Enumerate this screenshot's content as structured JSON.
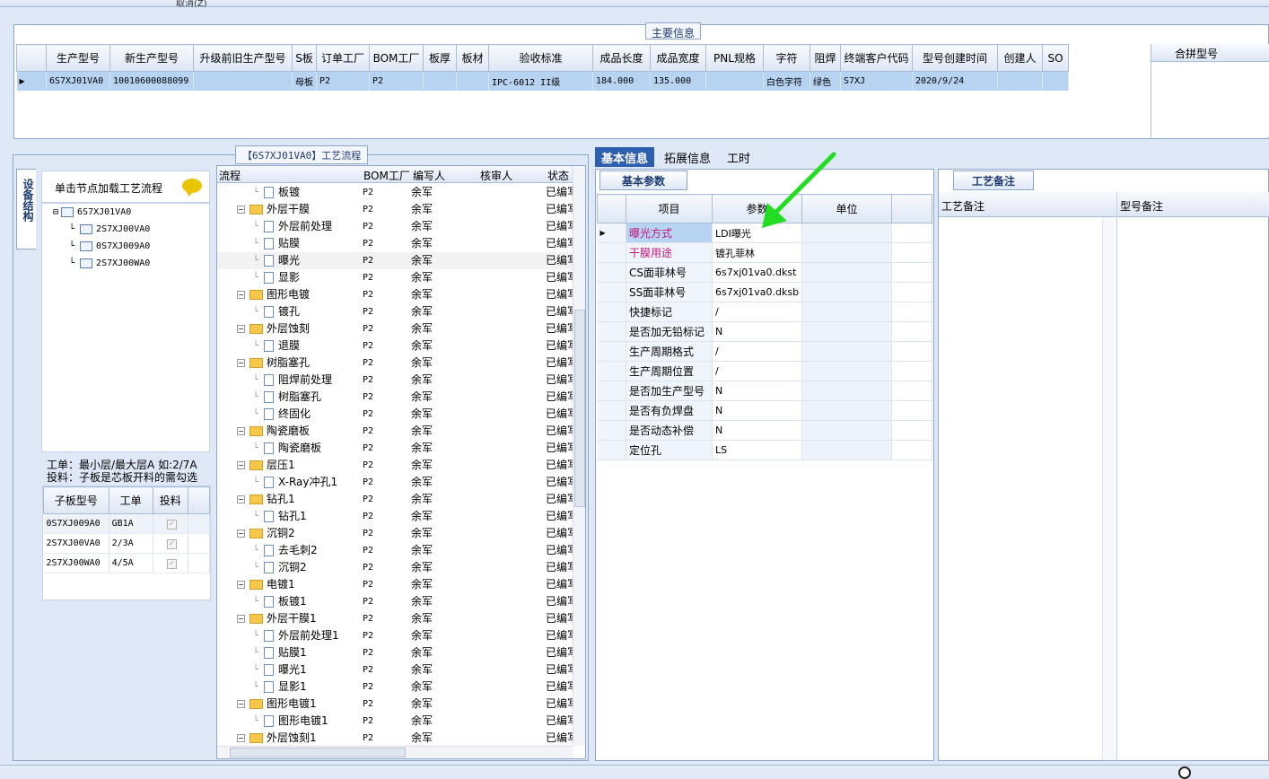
{
  "toolbar": {
    "cancel_label": "取消(Z)"
  },
  "main_info": {
    "legend": "主要信息",
    "columns": [
      "生产型号",
      "新生产型号",
      "升级前旧生产型号",
      "S板",
      "订单工厂",
      "BOM工厂",
      "板厚",
      "板材",
      "验收标准",
      "成品长度",
      "成品宽度",
      "PNL规格",
      "字符",
      "阻焊",
      "终端客户代码",
      "型号创建时间",
      "创建人",
      "SO"
    ],
    "row": [
      "6S7XJ01VA0",
      "10010600088099",
      "",
      "母板",
      "P2",
      "P2",
      "",
      "",
      "IPC-6012 II级",
      "184.000",
      "135.000",
      "",
      "白色字符",
      "绿色",
      "S7XJ",
      "2020/9/24",
      "",
      ""
    ],
    "merge_col": "合拼型号"
  },
  "left_panel": {
    "title": "【6S7XJ01VA0】工艺流程",
    "vertical_tab": "设备结构",
    "node_load_text": "单击节点加载工艺流程",
    "tree_root": "6S7XJ01VA0",
    "tree_children": [
      "2S7XJ00VA0",
      "0S7XJ009A0",
      "2S7XJ00WA0"
    ],
    "note_line1": "工单：最小层/最大层A 如:2/7A",
    "note_line2": "投料：子板是芯板开料的需勾选",
    "sub_columns": [
      "子板型号",
      "工单",
      "投料"
    ],
    "sub_rows": [
      {
        "model": "0S7XJ009A0",
        "order": "GB1A",
        "check": "✓"
      },
      {
        "model": "2S7XJ00VA0",
        "order": "2/3A",
        "check": "✓"
      },
      {
        "model": "2S7XJ00WA0",
        "order": "4/5A",
        "check": "✓"
      }
    ]
  },
  "flow": {
    "columns": {
      "process": "流程",
      "bom": "BOM工厂",
      "writer": "编写人",
      "reviewer": "核审人",
      "status": "状态"
    },
    "rows": [
      {
        "name": "板镀",
        "level": 2,
        "bom": "P2",
        "writer": "余军",
        "status": "已编写"
      },
      {
        "name": "外层干膜",
        "level": 1,
        "bom": "P2",
        "writer": "余军",
        "status": "已编写"
      },
      {
        "name": "外层前处理",
        "level": 2,
        "bom": "P2",
        "writer": "余军",
        "status": "已编写"
      },
      {
        "name": "贴膜",
        "level": 2,
        "bom": "P2",
        "writer": "余军",
        "status": "已编写"
      },
      {
        "name": "曝光",
        "level": 2,
        "bom": "P2",
        "writer": "余军",
        "status": "已编写"
      },
      {
        "name": "显影",
        "level": 2,
        "bom": "P2",
        "writer": "余军",
        "status": "已编写"
      },
      {
        "name": "图形电镀",
        "level": 1,
        "bom": "P2",
        "writer": "余军",
        "status": "已编写"
      },
      {
        "name": "镀孔",
        "level": 2,
        "bom": "P2",
        "writer": "余军",
        "status": "已编写"
      },
      {
        "name": "外层蚀刻",
        "level": 1,
        "bom": "P2",
        "writer": "余军",
        "status": "已编写"
      },
      {
        "name": "退膜",
        "level": 2,
        "bom": "P2",
        "writer": "余军",
        "status": "已编写"
      },
      {
        "name": "树脂塞孔",
        "level": 1,
        "bom": "P2",
        "writer": "余军",
        "status": "已编写"
      },
      {
        "name": "阻焊前处理",
        "level": 2,
        "bom": "P2",
        "writer": "余军",
        "status": "已编写"
      },
      {
        "name": "树脂塞孔",
        "level": 2,
        "bom": "P2",
        "writer": "余军",
        "status": "已编写"
      },
      {
        "name": "终固化",
        "level": 2,
        "bom": "P2",
        "writer": "余军",
        "status": "已编写"
      },
      {
        "name": "陶瓷磨板",
        "level": 1,
        "bom": "P2",
        "writer": "余军",
        "status": "已编写"
      },
      {
        "name": "陶瓷磨板",
        "level": 2,
        "bom": "P2",
        "writer": "余军",
        "status": "已编写"
      },
      {
        "name": "层压1",
        "level": 1,
        "bom": "P2",
        "writer": "余军",
        "status": "已编写"
      },
      {
        "name": "X-Ray冲孔1",
        "level": 2,
        "bom": "P2",
        "writer": "余军",
        "status": "已编写"
      },
      {
        "name": "钻孔1",
        "level": 1,
        "bom": "P2",
        "writer": "余军",
        "status": "已编写"
      },
      {
        "name": "钻孔1",
        "level": 2,
        "bom": "P2",
        "writer": "余军",
        "status": "已编写"
      },
      {
        "name": "沉铜2",
        "level": 1,
        "bom": "P2",
        "writer": "余军",
        "status": "已编写"
      },
      {
        "name": "去毛刺2",
        "level": 2,
        "bom": "P2",
        "writer": "余军",
        "status": "已编写"
      },
      {
        "name": "沉铜2",
        "level": 2,
        "bom": "P2",
        "writer": "余军",
        "status": "已编写"
      },
      {
        "name": "电镀1",
        "level": 1,
        "bom": "P2",
        "writer": "余军",
        "status": "已编写"
      },
      {
        "name": "板镀1",
        "level": 2,
        "bom": "P2",
        "writer": "余军",
        "status": "已编写"
      },
      {
        "name": "外层干膜1",
        "level": 1,
        "bom": "P2",
        "writer": "余军",
        "status": "已编写"
      },
      {
        "name": "外层前处理1",
        "level": 2,
        "bom": "P2",
        "writer": "余军",
        "status": "已编写"
      },
      {
        "name": "贴膜1",
        "level": 2,
        "bom": "P2",
        "writer": "余军",
        "status": "已编写"
      },
      {
        "name": "曝光1",
        "level": 2,
        "bom": "P2",
        "writer": "余军",
        "status": "已编写"
      },
      {
        "name": "显影1",
        "level": 2,
        "bom": "P2",
        "writer": "余军",
        "status": "已编写"
      },
      {
        "name": "图形电镀1",
        "level": 1,
        "bom": "P2",
        "writer": "余军",
        "status": "已编写"
      },
      {
        "name": "图形电镀1",
        "level": 2,
        "bom": "P2",
        "writer": "余军",
        "status": "已编写"
      },
      {
        "name": "外层蚀刻1",
        "level": 1,
        "bom": "P2",
        "writer": "余军",
        "status": "已编写"
      }
    ]
  },
  "tabs": [
    "基本信息",
    "拓展信息",
    "工时"
  ],
  "basic": {
    "tab": "基本参数",
    "columns": [
      "项目",
      "参数",
      "单位"
    ],
    "rows": [
      {
        "k": "曝光方式",
        "v": "LDI曝光",
        "u": "",
        "pink": true
      },
      {
        "k": "干膜用途",
        "v": "镀孔菲林",
        "u": "",
        "pink": true
      },
      {
        "k": "CS面菲林号",
        "v": "6s7xj01va0.dkst",
        "u": ""
      },
      {
        "k": "SS面菲林号",
        "v": "6s7xj01va0.dksb",
        "u": ""
      },
      {
        "k": "快捷标记",
        "v": "/",
        "u": ""
      },
      {
        "k": "是否加无铅标记",
        "v": "N",
        "u": ""
      },
      {
        "k": "生产周期格式",
        "v": "/",
        "u": ""
      },
      {
        "k": "生产周期位置",
        "v": "/",
        "u": ""
      },
      {
        "k": "是否加生产型号",
        "v": "N",
        "u": ""
      },
      {
        "k": "是否有负焊盘",
        "v": "N",
        "u": ""
      },
      {
        "k": "是否动态补偿",
        "v": "N",
        "u": ""
      },
      {
        "k": "定位孔",
        "v": "LS",
        "u": ""
      }
    ]
  },
  "craft": {
    "tab": "工艺备注",
    "col1": "工艺备注",
    "col2": "型号备注"
  },
  "colors": {
    "accent": "#2e5fae",
    "selected_row": "#b7d3f2",
    "pink_label": "#c0177e",
    "arrow": "#22dd22"
  }
}
